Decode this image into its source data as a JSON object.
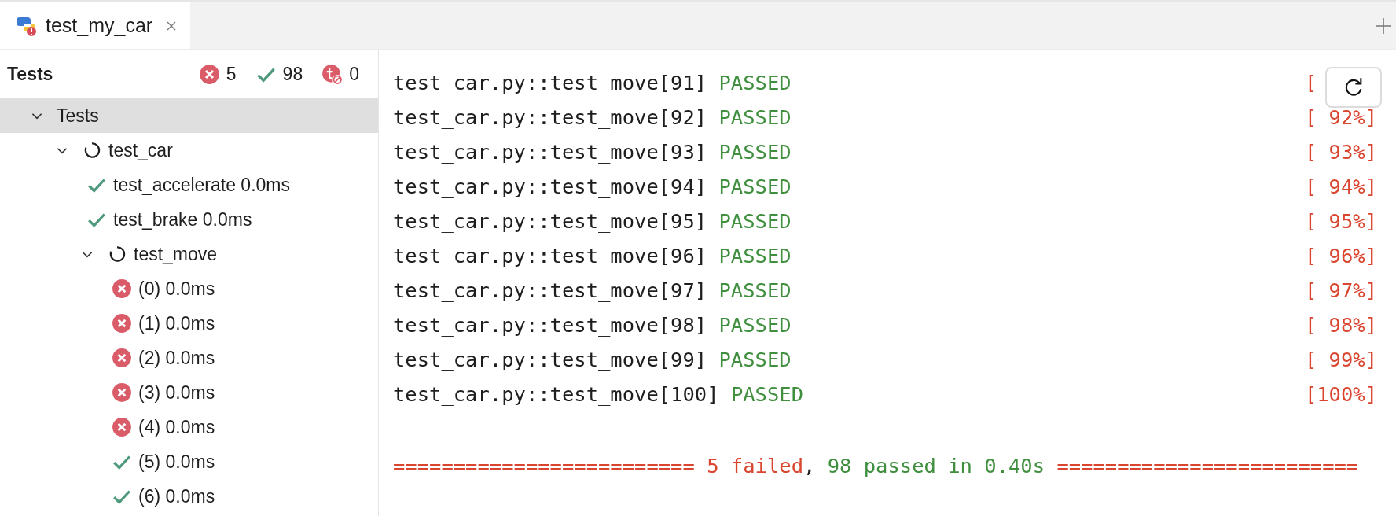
{
  "tab": {
    "title": "test_my_car",
    "selected": true
  },
  "summary": {
    "label": "Tests",
    "failed": "5",
    "passed": "98",
    "ignored": "0"
  },
  "tree": [
    {
      "label": "Tests",
      "expanded": true,
      "selected": true,
      "children": [
        {
          "label": "test_car",
          "kind": "running",
          "expanded": true,
          "selected": false,
          "children": [
            {
              "label": "test_accelerate 0.0ms",
              "kind": "passed",
              "selected": false
            },
            {
              "label": "test_brake 0.0ms",
              "kind": "passed",
              "selected": false
            },
            {
              "label": "test_move",
              "kind": "running",
              "expanded": true,
              "selected": false,
              "children": [
                {
                  "label": "(0) 0.0ms",
                  "kind": "failed",
                  "selected": false
                },
                {
                  "label": "(1) 0.0ms",
                  "kind": "failed",
                  "selected": false
                },
                {
                  "label": "(2) 0.0ms",
                  "kind": "failed",
                  "selected": false
                },
                {
                  "label": "(3) 0.0ms",
                  "kind": "failed",
                  "selected": false
                },
                {
                  "label": "(4) 0.0ms",
                  "kind": "failed",
                  "selected": false
                },
                {
                  "label": "(5) 0.0ms",
                  "kind": "passed",
                  "selected": false
                },
                {
                  "label": "(6) 0.0ms",
                  "kind": "passed",
                  "selected": false
                }
              ]
            }
          ]
        }
      ]
    }
  ],
  "console": [
    {
      "test": "test_car.py::test_move[91]",
      "result": "PASSED",
      "progress": "["
    },
    {
      "test": "test_car.py::test_move[92]",
      "result": "PASSED",
      "progress": "[ 92%]"
    },
    {
      "test": "test_car.py::test_move[93]",
      "result": "PASSED",
      "progress": "[ 93%]"
    },
    {
      "test": "test_car.py::test_move[94]",
      "result": "PASSED",
      "progress": "[ 94%]"
    },
    {
      "test": "test_car.py::test_move[95]",
      "result": "PASSED",
      "progress": "[ 95%]"
    },
    {
      "test": "test_car.py::test_move[96]",
      "result": "PASSED",
      "progress": "[ 96%]"
    },
    {
      "test": "test_car.py::test_move[97]",
      "result": "PASSED",
      "progress": "[ 97%]"
    },
    {
      "test": "test_car.py::test_move[98]",
      "result": "PASSED",
      "progress": "[ 98%]"
    },
    {
      "test": "test_car.py::test_move[99]",
      "result": "PASSED",
      "progress": "[ 99%]"
    },
    {
      "test": "test_car.py::test_move[100]",
      "result": "PASSED",
      "progress": "[100%]"
    }
  ],
  "result_line": [
    {
      "text": "========================= 5 failed",
      "kind": "failed"
    },
    {
      "text": ", ",
      "kind": "plain"
    },
    {
      "text": "98 passed in 0.40s",
      "kind": "passed"
    },
    {
      "text": " =========================",
      "kind": "failed"
    }
  ]
}
